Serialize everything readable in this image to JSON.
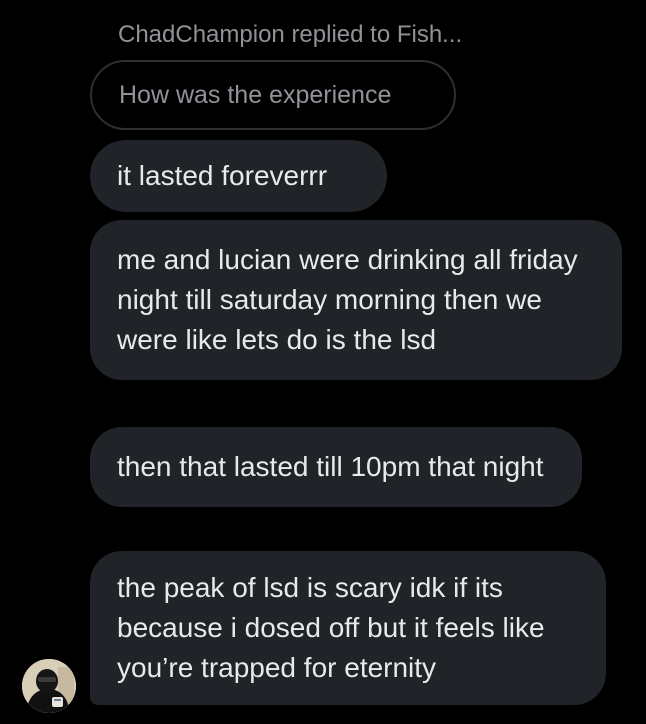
{
  "thread": {
    "reply_header": "ChadChampion replied to Fish...",
    "quoted_message": "How was the experience"
  },
  "messages": [
    {
      "text": "it lasted foreverrr"
    },
    {
      "text": "me and lucian were drinking all friday night till saturday morning then we were like lets do is the lsd"
    },
    {
      "text": "then that lasted till 10pm that night"
    },
    {
      "text": "the peak of lsd is scary idk if its because i dosed off but it feels like you’re trapped for eternity"
    }
  ],
  "colors": {
    "background": "#000000",
    "bubble": "#202327",
    "message_text": "#e7e9ea",
    "muted_text": "#8f9398",
    "quoted_border": "#2c2f33"
  },
  "icons": {
    "avatar": "user-avatar-icon"
  }
}
